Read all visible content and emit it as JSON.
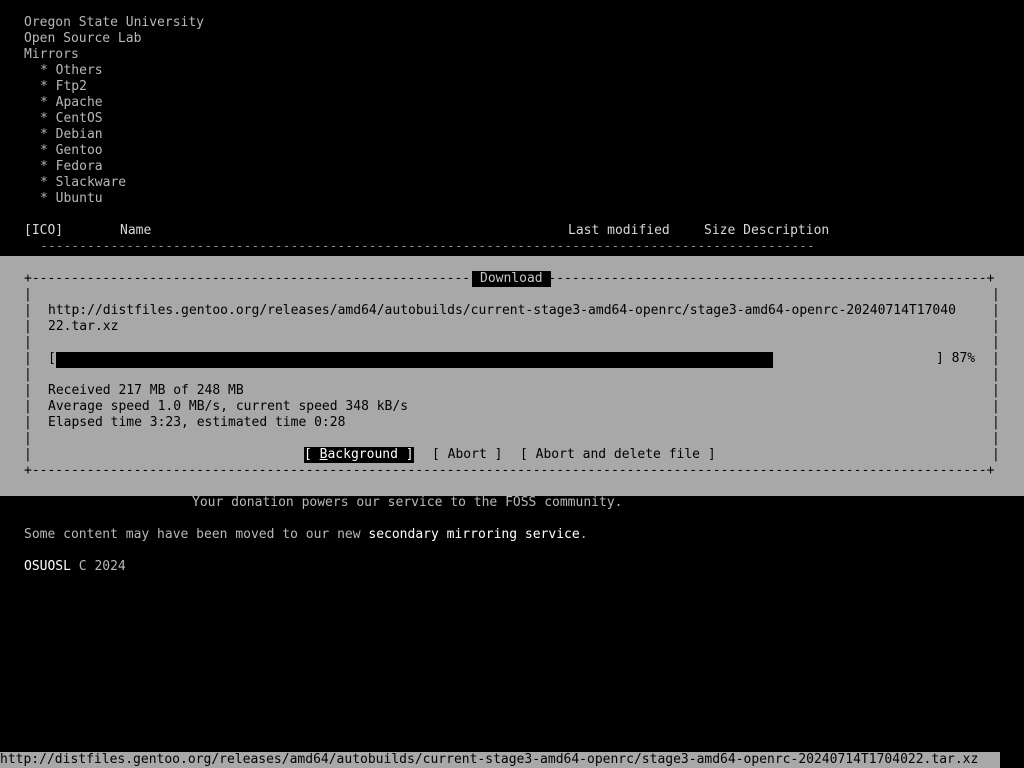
{
  "header": {
    "line1": "Oregon State University",
    "line2": "Open Source Lab",
    "line3": "Mirrors"
  },
  "mirrors": [
    "* Others",
    "* Ftp2",
    "* Apache",
    "* CentOS",
    "* Debian",
    "* Gentoo",
    "* Fedora",
    "* Slackware",
    "* Ubuntu"
  ],
  "table": {
    "ico": "[ICO]",
    "name": "Name",
    "last_modified": "Last modified",
    "size_description": "Size Description",
    "rule": "----------------------------------------------------------------------------------------------------------------"
  },
  "dialog": {
    "title": "Download",
    "url_line1": "http://distfiles.gentoo.org/releases/amd64/autobuilds/current-stage3-amd64-openrc/stage3-amd64-openrc-20240714T17040",
    "url_line2": "22.tar.xz",
    "progress_open": "[",
    "progress_close": "] 87%",
    "progress_fraction": 0.87,
    "received": "Received 217 MB of 248 MB",
    "speed": "Average speed 1.0 MB/s, current speed 348 kB/s",
    "elapsed": "Elapsed time 3:23, estimated time 0:28",
    "buttons": {
      "background_open": "[ ",
      "background_hot": "B",
      "background_rest": "ackground ]",
      "abort": "[ Abort ]",
      "abort_delete": "[ Abort and delete file ]"
    },
    "border_top_left": "+--------------------------------------------------------------------------------------------------------------------------+",
    "border_bottom": "+--------------------------------------------------------------------------------------------------------------------------+"
  },
  "footer": {
    "donation": "Your donation powers our service to the FOSS community.",
    "moved_prefix": "Some content may have been moved to our new ",
    "moved_link": "secondary mirroring service",
    "moved_suffix": ".",
    "copyright_brand": "OSUOSL",
    "copyright_rest": " C 2024"
  },
  "statusbar": {
    "url": "http://distfiles.gentoo.org/releases/amd64/autobuilds/current-stage3-amd64-openrc/stage3-amd64-openrc-20240714T1704022.tar.xz"
  },
  "colors": {
    "background": "#000000",
    "dialog_bg": "#a8a8a8",
    "text": "#b8b8b8"
  }
}
